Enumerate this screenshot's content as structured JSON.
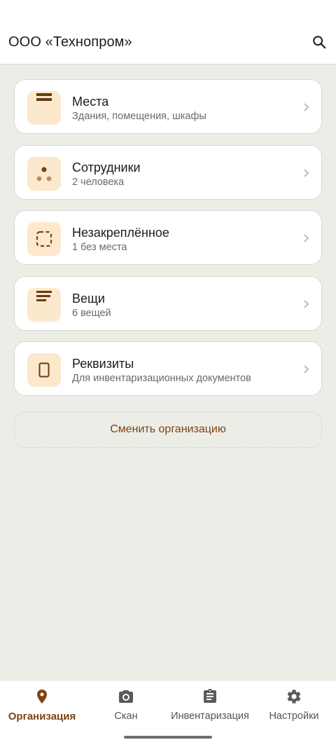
{
  "header": {
    "title": "ООО «Технопром»",
    "search_icon": "search-icon"
  },
  "cards": [
    {
      "title": "Места",
      "subtitle": "Здания, помещения, шкафы",
      "icon": "places-icon"
    },
    {
      "title": "Сотрудники",
      "subtitle": "2 человека",
      "icon": "people-icon"
    },
    {
      "title": "Незакреплённое",
      "subtitle": "1 без места",
      "icon": "unassigned-icon"
    },
    {
      "title": "Вещи",
      "subtitle": "6 вещей",
      "icon": "items-icon"
    },
    {
      "title": "Реквизиты",
      "subtitle": "Для инвентаризационных документов",
      "icon": "document-icon"
    }
  ],
  "switch_org": {
    "label": "Сменить организацию"
  },
  "bottom_nav": {
    "items": [
      {
        "label": "Организация",
        "icon": "location-pin-icon",
        "active": true
      },
      {
        "label": "Скан",
        "icon": "camera-icon",
        "active": false
      },
      {
        "label": "Инвентаризация",
        "icon": "clipboard-icon",
        "active": false
      },
      {
        "label": "Настройки",
        "icon": "gear-icon",
        "active": false
      }
    ]
  },
  "colors": {
    "accent": "#7a4514",
    "icon_bg": "#fbe8cd",
    "background": "#edede8"
  }
}
